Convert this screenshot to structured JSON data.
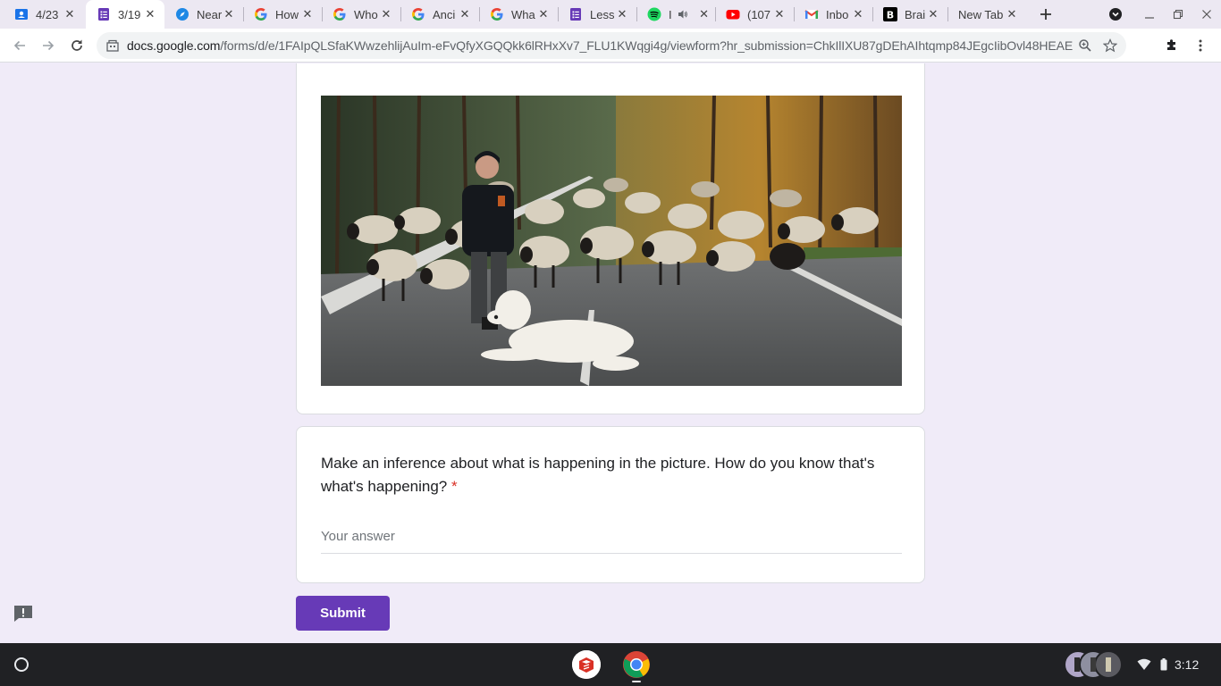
{
  "browser": {
    "tabs": [
      {
        "label": "4/23",
        "icon": "google-classroom-icon",
        "active": false
      },
      {
        "label": "3/19",
        "icon": "google-forms-icon",
        "active": true
      },
      {
        "label": "Near",
        "icon": "safari-compass-icon",
        "active": false
      },
      {
        "label": "How",
        "icon": "google-g-icon",
        "active": false
      },
      {
        "label": "Who",
        "icon": "google-g-icon",
        "active": false
      },
      {
        "label": "Anci",
        "icon": "google-g-icon",
        "active": false
      },
      {
        "label": "Wha",
        "icon": "google-g-icon",
        "active": false
      },
      {
        "label": "Less",
        "icon": "google-forms-icon",
        "active": false
      },
      {
        "label": "I",
        "icon": "spotify-icon",
        "active": false
      },
      {
        "label": "(107",
        "icon": "youtube-icon",
        "active": false
      },
      {
        "label": "Inbo",
        "icon": "gmail-icon",
        "active": false
      },
      {
        "label": "Brai",
        "icon": "brainly-icon",
        "active": false
      },
      {
        "label": "New Tab",
        "icon": "",
        "active": false
      }
    ],
    "url_host": "docs.google.com",
    "url_path": "/forms/d/e/1FAIpQLSfaKWwzehlijAuIm-eFvQfyXGQQkk6lRHxXv7_FLU1KWqgi4g/viewform?hr_submission=ChkIlIXU87gDEhAIhtqmp84JEgcIibOvl48HEAE"
  },
  "form": {
    "question": "Make an inference about what is happening in the picture. How do you know that's what's happening?",
    "required_mark": "*",
    "answer_placeholder": "Your answer",
    "submit_label": "Submit"
  },
  "shelf": {
    "time": "3:12"
  },
  "colors": {
    "form_accent": "#673ab7",
    "page_bg": "#f0ebf8",
    "required": "#d93025"
  }
}
